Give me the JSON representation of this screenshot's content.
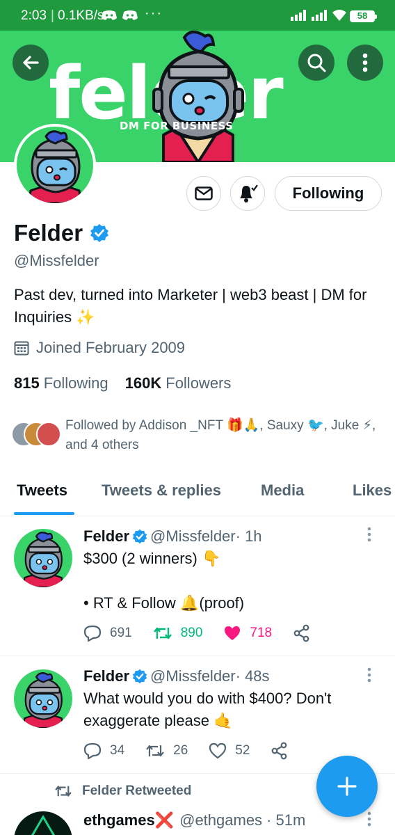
{
  "status_bar": {
    "time": "2:03",
    "separator": "|",
    "net_speed": "0.1KB/s",
    "overflow": "···",
    "battery": "58"
  },
  "banner": {
    "wordmark": "felder",
    "tagline": "DM FOR BUSINESS",
    "accent_color": "#3ad36a"
  },
  "profile": {
    "name": "Felder",
    "handle": "@Missfelder",
    "bio": "Past dev, turned into Marketer | web3 beast | DM for Inquiries ✨",
    "joined": "Joined February 2009",
    "following_count": "815",
    "following_label": "Following",
    "followers_count": "160K",
    "followers_label": "Followers",
    "followed_by": "Followed by Addison _NFT 🎁🙏, Sauxy 🐦, Juke ⚡, and 4 others",
    "follow_button": "Following"
  },
  "tabs": [
    "Tweets",
    "Tweets & replies",
    "Media",
    "Likes"
  ],
  "active_tab": "Tweets",
  "tweets": [
    {
      "name": "Felder",
      "handle": "@Missfelder",
      "time": "· 1h",
      "text": "$300 (2 winners) 👇\n\n• RT & Follow 🔔(proof)",
      "replies": "691",
      "retweets": "890",
      "likes": "718",
      "retweeted": true,
      "liked": true
    },
    {
      "name": "Felder",
      "handle": "@Missfelder",
      "time": "· 48s",
      "text": "What would you do with $400? Don't exaggerate please 🤙",
      "replies": "34",
      "retweets": "26",
      "likes": "52",
      "retweeted": false,
      "liked": false
    },
    {
      "retweeted_by": "Felder Retweeted",
      "name": "ethgames❌",
      "handle": "@ethgames",
      "time": "· 51m"
    }
  ],
  "colors": {
    "brand_blue": "#1d9bf0",
    "retweet_green": "#00ba7c",
    "like_pink": "#f91880",
    "muted_text": "#536471"
  },
  "icons": [
    "back-arrow-icon",
    "search-icon",
    "more-vertical-icon",
    "mail-icon",
    "bell-icon",
    "calendar-icon",
    "verified-badge-icon",
    "reply-icon",
    "retweet-icon",
    "heart-icon",
    "share-icon",
    "plus-icon"
  ]
}
